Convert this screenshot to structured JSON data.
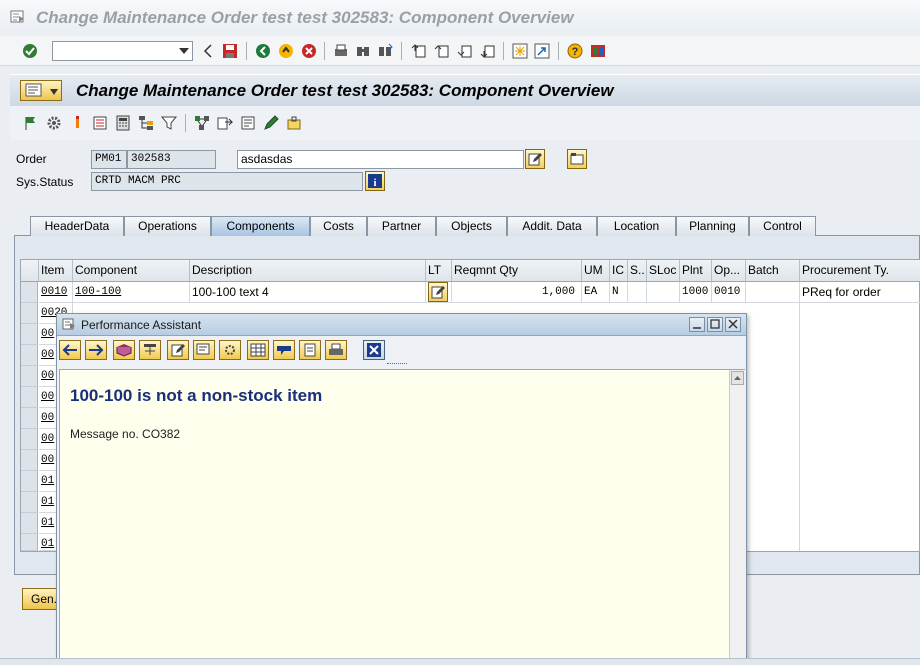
{
  "window": {
    "title": "Change Maintenance Order test test 302583: Component Overview"
  },
  "toolbar": {
    "command_value": ""
  },
  "header": {
    "title": "Change Maintenance Order test test 302583: Component Overview"
  },
  "order": {
    "label": "Order",
    "type": "PM01",
    "number": "302583",
    "description": "asdasdas",
    "status_label": "Sys.Status",
    "status": "CRTD MACM PRC"
  },
  "tabs": [
    {
      "label": "HeaderData",
      "active": false
    },
    {
      "label": "Operations",
      "active": false
    },
    {
      "label": "Components",
      "active": true
    },
    {
      "label": "Costs",
      "active": false
    },
    {
      "label": "Partner",
      "active": false
    },
    {
      "label": "Objects",
      "active": false
    },
    {
      "label": "Addit. Data",
      "active": false
    },
    {
      "label": "Location",
      "active": false
    },
    {
      "label": "Planning",
      "active": false
    },
    {
      "label": "Control",
      "active": false
    }
  ],
  "grid": {
    "columns": [
      "Item",
      "Component",
      "Description",
      "LT",
      "Reqmnt Qty",
      "UM",
      "IC",
      "S..",
      "SLoc",
      "Plnt",
      "Op...",
      "Batch",
      "Procurement Ty."
    ],
    "row": {
      "item": "0010",
      "component": "100-100",
      "description": "100-100 text 4",
      "qty": "1,000",
      "um": "EA",
      "ic": "N",
      "plant": "1000",
      "operation": "0010",
      "procurement": "PReq for order"
    },
    "partial_items": [
      "0020",
      "00",
      "00",
      "00",
      "00",
      "00",
      "00",
      "00",
      "01",
      "01",
      "01",
      "01"
    ]
  },
  "buttons": {
    "generate": "Gen."
  },
  "popup": {
    "title": "Performance Assistant",
    "heading": "100-100 is not a non-stock item",
    "message": "Message no. CO382"
  }
}
